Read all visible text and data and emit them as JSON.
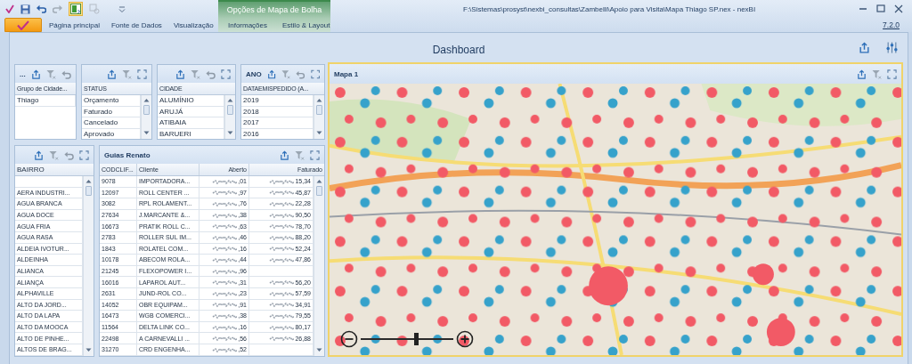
{
  "window": {
    "title": "F:\\Sistemas\\prosyst\\nexbi_consultas\\Zambelli\\Apoio para Visita\\Mapa Thiago SP.nex - nexBI",
    "version": "7.2.0"
  },
  "ribbon": {
    "contextual_group": "Opções de Mapa de Bolha",
    "tabs": [
      {
        "label": "Página principal",
        "selected": false,
        "contextual": false
      },
      {
        "label": "Fonte de Dados",
        "selected": false,
        "contextual": false
      },
      {
        "label": "Visualização",
        "selected": false,
        "contextual": false
      },
      {
        "label": "Informações",
        "selected": false,
        "contextual": true
      },
      {
        "label": "Estilo & Layout",
        "selected": false,
        "contextual": true
      }
    ]
  },
  "dashboard": {
    "title": "Dashboard"
  },
  "filters": [
    {
      "caption": "...",
      "column": "Grupo de Cidade...",
      "items": [
        "Thiago"
      ]
    },
    {
      "column": "STATUS",
      "items": [
        "Orçamento",
        "Faturado",
        "Cancelado",
        "Aprovado"
      ]
    },
    {
      "column": "CIDADE",
      "items": [
        "ALUMÍNIO",
        "ARUJÁ",
        "ATIBAIA",
        "BARUERI"
      ]
    },
    {
      "caption": "ANO",
      "column": "DATAEMISPEDIDO (A...",
      "items": [
        "2019",
        "2018",
        "2017",
        "2016"
      ]
    }
  ],
  "bairro": {
    "column": "BAIRRO",
    "rows": [
      {
        "blank": true
      },
      {
        "name": "AERA INDUSTRI..."
      },
      {
        "name": "AGUA BRANCA"
      },
      {
        "name": "AGUA DOCE"
      },
      {
        "name": "AGUA FRIA"
      },
      {
        "name": "AGUA RASA"
      },
      {
        "name": "ALDEIA IVOTUR..."
      },
      {
        "name": "ALDEINHA"
      },
      {
        "name": "ALIANCA"
      },
      {
        "name": "ALIANÇA"
      },
      {
        "name": "ALPHAVILLE"
      },
      {
        "name": "ALTO DA JORD..."
      },
      {
        "name": "ALTO DA LAPA"
      },
      {
        "name": "ALTO DA MOOCA"
      },
      {
        "name": "ALTO DE PINHE..."
      },
      {
        "name": "ALTOS DE BRAG..."
      }
    ]
  },
  "guias": {
    "title": "Guias Renato",
    "columns": [
      "CODCLIF...",
      "Cliente",
      "Aberto",
      "Faturado"
    ],
    "rows": [
      {
        "code": "9078",
        "client": "IMPORTADORA...",
        "open": ",01",
        "billed": "15,34"
      },
      {
        "code": "12097",
        "client": "ROLL CENTER ...",
        "open": ",97",
        "billed": "45,87"
      },
      {
        "code": "3082",
        "client": "RPL ROLAMENT...",
        "open": ",76",
        "billed": "22,28"
      },
      {
        "code": "27634",
        "client": "J.MARCANTE &...",
        "open": ",38",
        "billed": "90,50"
      },
      {
        "code": "16673",
        "client": "PRATIK ROLL C...",
        "open": ",63",
        "billed": "78,70"
      },
      {
        "code": "2783",
        "client": "ROLLER SUL IM...",
        "open": ",46",
        "billed": "88,20"
      },
      {
        "code": "1843",
        "client": "ROLATEL COM...",
        "open": ",16",
        "billed": "52,24"
      },
      {
        "code": "10178",
        "client": "ABECOM ROLA...",
        "open": ",44",
        "billed": "47,86"
      },
      {
        "code": "21245",
        "client": "FLEXOPOWER I...",
        "open": ",96"
      },
      {
        "code": "16016",
        "client": "LAPAROL AUT...",
        "open": ",31",
        "billed": "56,20"
      },
      {
        "code": "2631",
        "client": "JUND-ROL CO...",
        "open": ",23",
        "billed": "57,59"
      },
      {
        "code": "14052",
        "client": "OBR EQUIPAM...",
        "open": ",91",
        "billed": "34,91"
      },
      {
        "code": "16473",
        "client": "WGB COMERCI...",
        "open": ",38",
        "billed": "79,55"
      },
      {
        "code": "11564",
        "client": "DELTA LINK CO...",
        "open": ",16",
        "billed": "80,17"
      },
      {
        "code": "22498",
        "client": "A CARNEVALLI ...",
        "open": ",56",
        "billed": "26,88"
      },
      {
        "code": "31270",
        "client": "CRD ENGENHA...",
        "open": ",52"
      }
    ]
  },
  "map": {
    "title": "Mapa 1",
    "zoom": {
      "level": 0.6
    }
  }
}
